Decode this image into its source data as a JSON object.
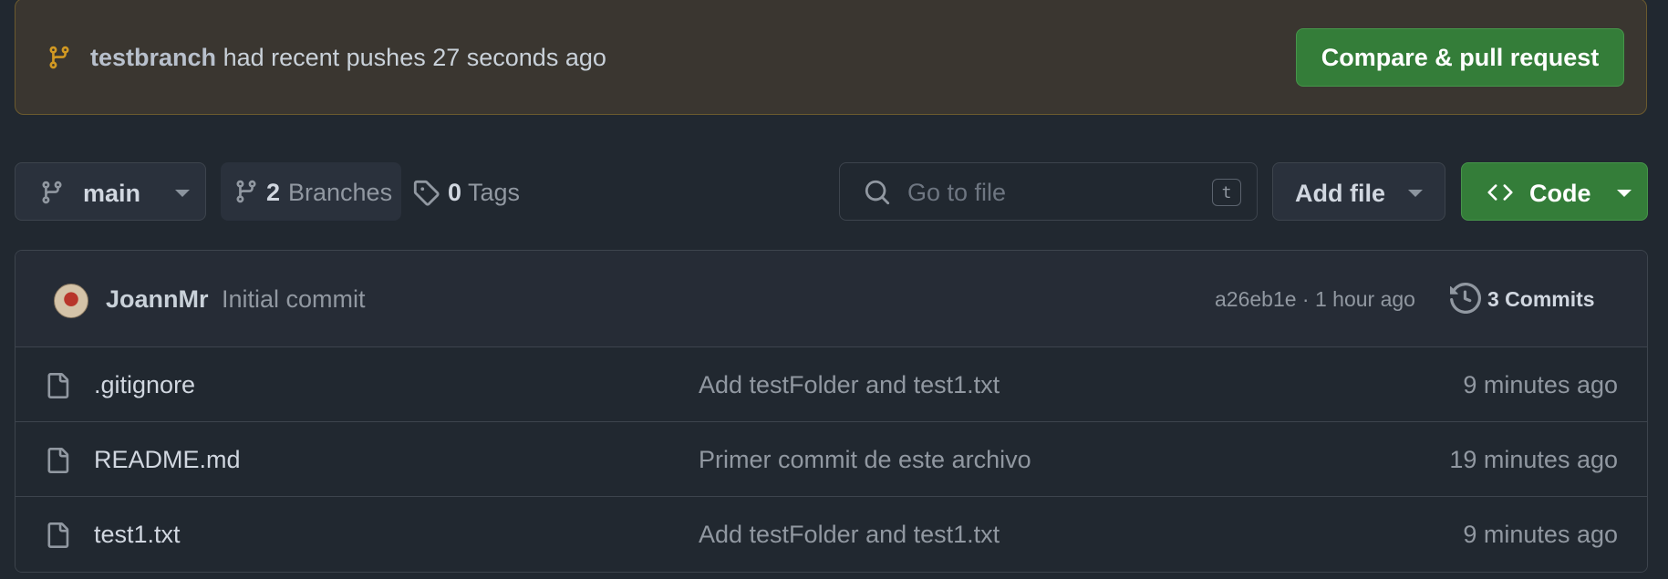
{
  "banner": {
    "branch_name": "testbranch",
    "message": "had recent pushes 27 seconds ago",
    "compare_button": "Compare & pull request"
  },
  "toolbar": {
    "current_branch": "main",
    "branches_count": "2",
    "branches_label": "Branches",
    "tags_count": "0",
    "tags_label": "Tags",
    "search_placeholder": "Go to file",
    "search_shortcut": "t",
    "add_file_label": "Add file",
    "code_label": "Code"
  },
  "latest_commit": {
    "author": "JoannMr",
    "message": "Initial commit",
    "meta": "a26eb1e · 1 hour ago",
    "commits_label": "3 Commits"
  },
  "files": [
    {
      "name": ".gitignore",
      "commit_message": "Add testFolder and test1.txt",
      "updated": "9 minutes ago"
    },
    {
      "name": "README.md",
      "commit_message": "Primer commit de este archivo",
      "updated": "19 minutes ago"
    },
    {
      "name": "test1.txt",
      "commit_message": "Add testFolder and test1.txt",
      "updated": "9 minutes ago"
    }
  ],
  "colors": {
    "background": "#212830",
    "banner_bg": "#3a3630",
    "banner_icon": "#d29922",
    "primary_button": "#347d39",
    "muted_text": "#9198a1"
  }
}
